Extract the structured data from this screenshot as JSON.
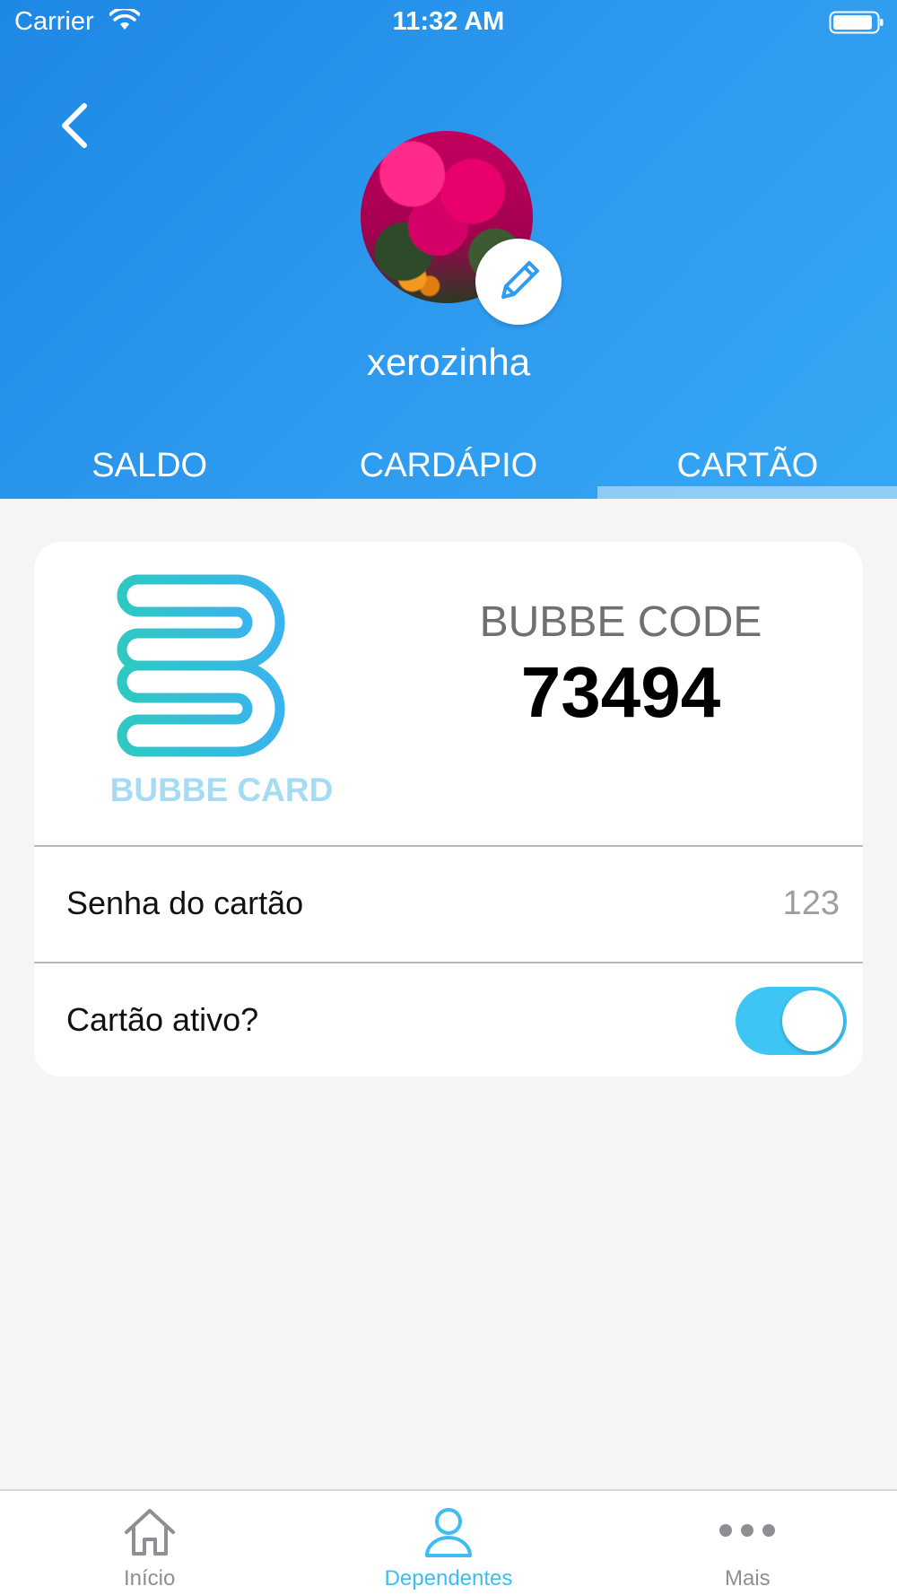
{
  "status_bar": {
    "carrier": "Carrier",
    "time": "11:32 AM"
  },
  "profile": {
    "name": "xerozinha"
  },
  "tabs": [
    {
      "label": "SALDO",
      "active": false
    },
    {
      "label": "CARDÁPIO",
      "active": false
    },
    {
      "label": "CARTÃO",
      "active": true
    }
  ],
  "card": {
    "logo_text": "BUBBE CARD",
    "code_label": "BUBBE CODE",
    "code_value": "73494",
    "password_label": "Senha do cartão",
    "password_value": "123",
    "active_label": "Cartão ativo?",
    "active": true
  },
  "tabbar": [
    {
      "label": "Início",
      "icon": "home-icon",
      "active": false
    },
    {
      "label": "Dependentes",
      "icon": "person-icon",
      "active": true
    },
    {
      "label": "Mais",
      "icon": "more-icon",
      "active": false
    }
  ],
  "colors": {
    "header_start": "#1e88e5",
    "header_end": "#35a7f3",
    "accent": "#3dc6f4",
    "tab_active": "#3dbdf0",
    "tab_inactive": "#8e8e93"
  }
}
